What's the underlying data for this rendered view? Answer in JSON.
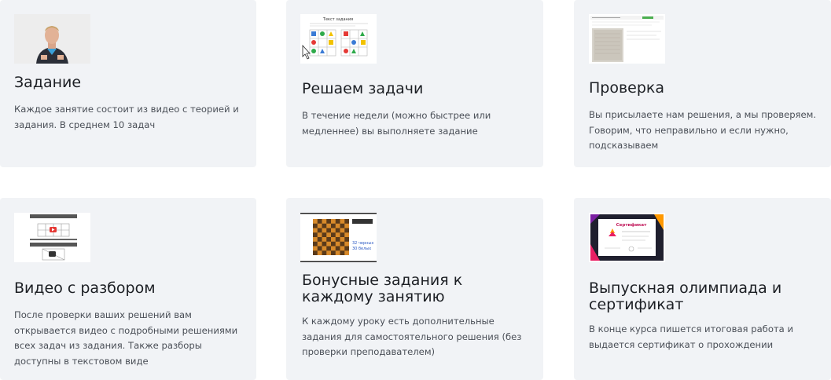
{
  "cards": [
    {
      "title": "Задание",
      "description": "Каждое занятие состоит из видео с теорией и задания. В среднем 10 задач",
      "thumbnail_icon": "teacher-video-icon"
    },
    {
      "title": "Решаем задачи",
      "description": "В течение недели (можно быстрее или медленнее) вы выполняете задание",
      "thumbnail_icon": "puzzle-task-icon",
      "thumbnail_text": "Текст задания"
    },
    {
      "title": "Проверка",
      "description": "Вы присылаете нам решения, а мы проверяем. Говорим, что неправильно и если нужно, подсказываем",
      "thumbnail_icon": "review-page-icon"
    },
    {
      "title": "Видео с разбором",
      "description": "После проверки ваших решений вам открывается видео с подробными решениями всех задач из задания. Также разборы доступны в текстовом виде",
      "thumbnail_icon": "video-player-icon"
    },
    {
      "title": "Бонусные задания к каждому занятию",
      "description": "К каждому уроку есть дополнительные задания для самостоятельного решения (без проверки преподавателем)",
      "thumbnail_icon": "chessboard-icon",
      "thumbnail_text": [
        "32 черных",
        "30 белых"
      ]
    },
    {
      "title": "Выпускная олимпиада и сертификат",
      "description": "В конце курса пишется итоговая работа и выдается сертификат о прохождении",
      "thumbnail_icon": "certificate-icon",
      "thumbnail_text": "Сертификат"
    }
  ],
  "colors": {
    "card_bg": "#f1f3f6",
    "title": "#1c1f24",
    "description": "#4a4f57"
  }
}
